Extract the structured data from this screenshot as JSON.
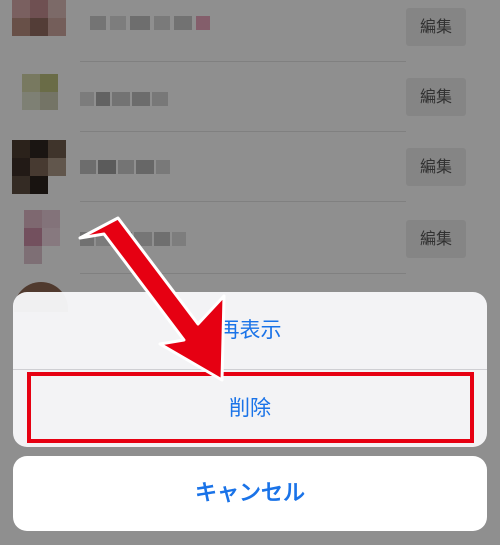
{
  "list": {
    "rows": [
      {
        "edit_label": "編集"
      },
      {
        "edit_label": "編集"
      },
      {
        "edit_label": "編集"
      },
      {
        "edit_label": "編集"
      }
    ]
  },
  "action_sheet": {
    "redisplay_label": "再表示",
    "delete_label": "削除",
    "cancel_label": "キャンセル"
  },
  "colors": {
    "accent": "#1a73e8",
    "annotation_red": "#e60012"
  }
}
